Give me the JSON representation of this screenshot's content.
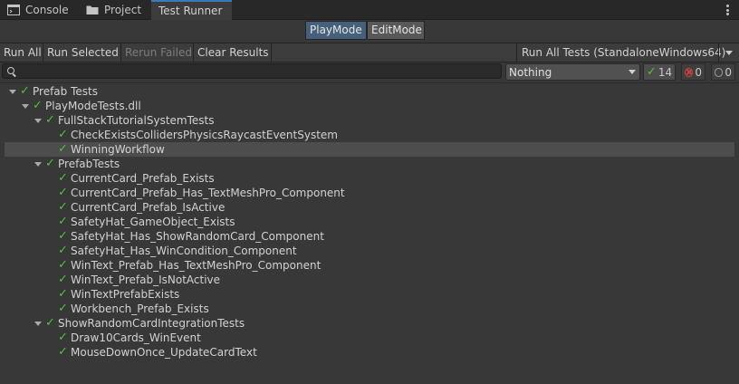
{
  "tabs": [
    {
      "label": "Console",
      "icon": "console-icon"
    },
    {
      "label": "Project",
      "icon": "folder-icon"
    },
    {
      "label": "Test Runner",
      "icon": "",
      "active": true
    }
  ],
  "mode": {
    "play": "PlayMode",
    "edit": "EditMode",
    "selected": "PlayMode"
  },
  "toolbar": {
    "run_all": "Run All",
    "run_selected": "Run Selected",
    "rerun_failed": "Rerun Failed",
    "clear_results": "Clear Results",
    "run_all_tests": "Run All Tests (StandaloneWindows64)"
  },
  "filter": {
    "search_value": "",
    "category_selected": "Nothing",
    "passed_count": "14",
    "failed_count": "0",
    "skipped_count": "0"
  },
  "tree": [
    {
      "label": "Prefab Tests",
      "depth": 0,
      "foldout": true,
      "status": "passed"
    },
    {
      "label": "PlayModeTests.dll",
      "depth": 1,
      "foldout": true,
      "status": "passed"
    },
    {
      "label": "FullStackTutorialSystemTests",
      "depth": 2,
      "foldout": true,
      "status": "passed"
    },
    {
      "label": "CheckExistsCollidersPhysicsRaycastEventSystem",
      "depth": 3,
      "foldout": false,
      "status": "passed"
    },
    {
      "label": "WinningWorkflow",
      "depth": 3,
      "foldout": false,
      "status": "passed",
      "selected": true
    },
    {
      "label": "PrefabTests",
      "depth": 2,
      "foldout": true,
      "status": "passed"
    },
    {
      "label": "CurrentCard_Prefab_Exists",
      "depth": 3,
      "foldout": false,
      "status": "passed"
    },
    {
      "label": "CurrentCard_Prefab_Has_TextMeshPro_Component",
      "depth": 3,
      "foldout": false,
      "status": "passed"
    },
    {
      "label": "CurrentCard_Prefab_IsActive",
      "depth": 3,
      "foldout": false,
      "status": "passed"
    },
    {
      "label": "SafetyHat_GameObject_Exists",
      "depth": 3,
      "foldout": false,
      "status": "passed"
    },
    {
      "label": "SafetyHat_Has_ShowRandomCard_Component",
      "depth": 3,
      "foldout": false,
      "status": "passed"
    },
    {
      "label": "SafetyHat_Has_WinCondition_Component",
      "depth": 3,
      "foldout": false,
      "status": "passed"
    },
    {
      "label": "WinText_Prefab_Has_TextMeshPro_Component",
      "depth": 3,
      "foldout": false,
      "status": "passed"
    },
    {
      "label": "WinText_Prefab_IsNotActive",
      "depth": 3,
      "foldout": false,
      "status": "passed"
    },
    {
      "label": "WinTextPrefabExists",
      "depth": 3,
      "foldout": false,
      "status": "passed"
    },
    {
      "label": "Workbench_Prefab_Exists",
      "depth": 3,
      "foldout": false,
      "status": "passed"
    },
    {
      "label": "ShowRandomCardIntegrationTests",
      "depth": 2,
      "foldout": true,
      "status": "passed"
    },
    {
      "label": "Draw10Cards_WinEvent",
      "depth": 3,
      "foldout": false,
      "status": "passed"
    },
    {
      "label": "MouseDownOnce_UpdateCardText",
      "depth": 3,
      "foldout": false,
      "status": "passed"
    }
  ],
  "colors": {
    "passed": "#4fc52b",
    "failed": "#d1403a",
    "accent": "#46607c"
  }
}
